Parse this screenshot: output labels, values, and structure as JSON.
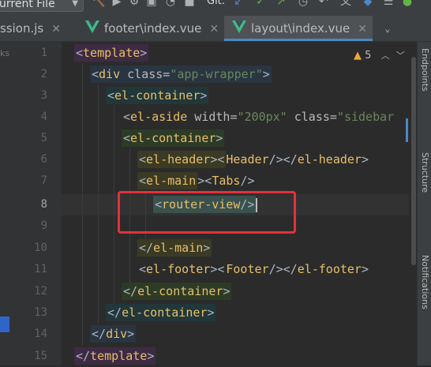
{
  "toolbar": {
    "run_config_label": "urrent File",
    "git_label": "Git:",
    "icons": [
      "chevron-down-icon",
      "build-icon",
      "run-icon",
      "debug-icon",
      "coverage-icon",
      "git-update-icon",
      "git-commit-icon",
      "git-push-icon",
      "history-icon",
      "rollback-icon",
      "settings-icon",
      "notifications-icon"
    ]
  },
  "tabs": [
    {
      "label": "ssion.js",
      "icon": "js-file-icon",
      "active": false
    },
    {
      "label": "footer\\index.vue",
      "icon": "vue-logo-icon",
      "active": false
    },
    {
      "label": "layout\\index.vue",
      "icon": "vue-logo-icon",
      "active": true
    }
  ],
  "left_strip": {
    "label": "ks"
  },
  "right_strip": {
    "labels": [
      "Endpoints",
      "Structure",
      "Notifications"
    ]
  },
  "editor": {
    "warnings_count": "5",
    "current_line": 8,
    "line_numbers": [
      "1",
      "2",
      "3",
      "4",
      "5",
      "6",
      "7",
      "8",
      "9",
      "10",
      "11",
      "12",
      "13",
      "14",
      "15"
    ],
    "lines": [
      [
        "<",
        "template",
        ">"
      ],
      [
        "<",
        "div",
        " class=",
        "\"app-wrapper\"",
        ">"
      ],
      [
        "<",
        "el-container",
        ">"
      ],
      [
        "<",
        "el-aside",
        " width=",
        "\"200px\"",
        " class=",
        "\"sidebar"
      ],
      [
        "<",
        "el-container",
        ">"
      ],
      [
        "<",
        "el-header",
        "><",
        "Header",
        "/></",
        "el-header",
        ">"
      ],
      [
        "<",
        "el-main",
        "><",
        "Tabs",
        "/>"
      ],
      [
        "<",
        "router-view",
        "/>"
      ],
      [],
      [
        "</",
        "el-main",
        ">"
      ],
      [
        "<",
        "el-footer",
        "><",
        "Footer",
        "/></",
        "el-footer",
        ">"
      ],
      [
        "</",
        "el-container",
        ">"
      ],
      [
        "</",
        "el-container",
        ">"
      ],
      [
        "</",
        "div",
        ">"
      ],
      [
        "</",
        "template",
        ">"
      ]
    ]
  },
  "colors": {
    "background": "#2b2b2b",
    "tag": "#e8bf6a",
    "attribute": "#bababa",
    "string": "#6a8759",
    "annotation": "#e5303c",
    "active_tab_underline": "#4a88c7"
  }
}
